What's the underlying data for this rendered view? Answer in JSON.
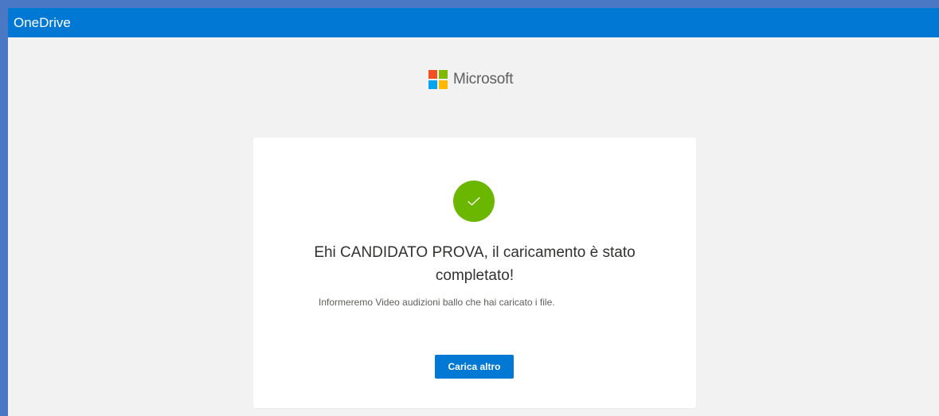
{
  "window": {
    "title": "OneDrive"
  },
  "brand": {
    "name": "Microsoft",
    "logo_colors": [
      "#f25022",
      "#7fba00",
      "#00a4ef",
      "#ffb900"
    ]
  },
  "confirmation": {
    "icon": "checkmark-icon",
    "icon_color": "#6bb700",
    "headline_line1": "Ehi CANDIDATO PROVA, il caricamento è stato",
    "headline_line2": "completato!",
    "message": "Informeremo Video audizioni ballo che hai caricato i file.",
    "button_label": "Carica altro"
  },
  "colors": {
    "accent": "#0078d4",
    "background": "#f2f2f2",
    "card": "#ffffff"
  }
}
